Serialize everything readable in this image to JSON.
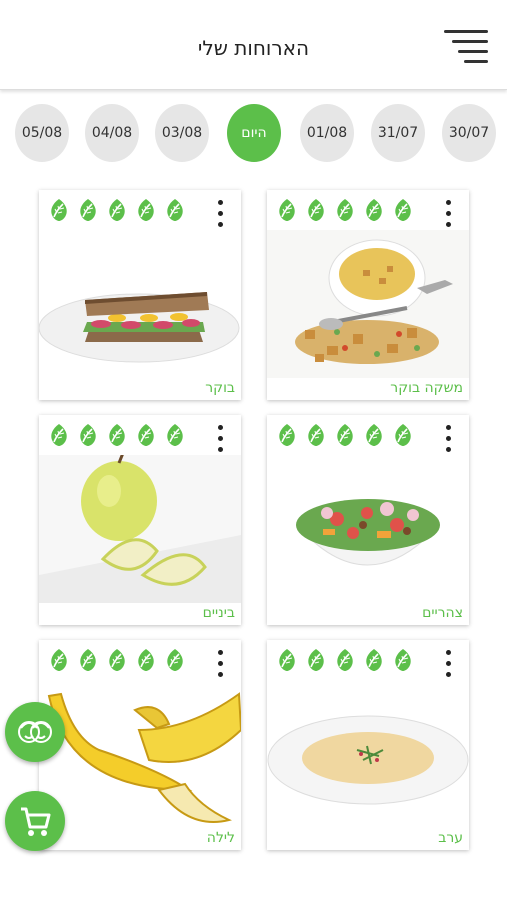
{
  "header": {
    "title": "הארוחות שלי",
    "menu_icon": "hamburger-menu-icon"
  },
  "dates": [
    {
      "label": "30/07",
      "active": false
    },
    {
      "label": "31/07",
      "active": false
    },
    {
      "label": "01/08",
      "active": false
    },
    {
      "label": "היום",
      "active": true
    },
    {
      "label": "03/08",
      "active": false
    },
    {
      "label": "04/08",
      "active": false
    },
    {
      "label": "05/08",
      "active": false
    }
  ],
  "meals": [
    {
      "label": "משקה בוקר",
      "image": "soup-with-croutons"
    },
    {
      "label": "בוקר",
      "image": "sandwich"
    },
    {
      "label": "צהריים",
      "image": "salad-bowl"
    },
    {
      "label": "ביניים",
      "image": "apple"
    },
    {
      "label": "ערב",
      "image": "cream-soup"
    },
    {
      "label": "לילה",
      "image": "bananas"
    }
  ],
  "fabs": {
    "nutritionist_icon": "nutritionist-faces-icon",
    "cart_icon": "shopping-cart-icon"
  },
  "colors": {
    "accent": "#5cbf4a",
    "chip_bg": "#e6e6e6"
  }
}
